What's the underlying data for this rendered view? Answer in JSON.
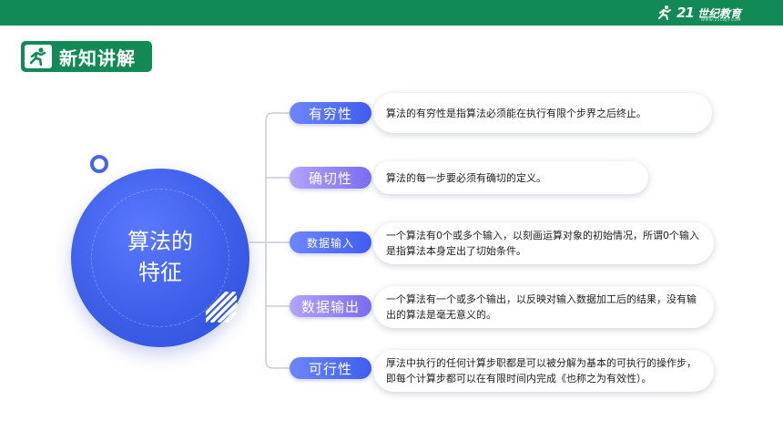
{
  "header": {
    "brand_mark": "21",
    "brand_text": "世纪教育",
    "brand_sub": "WWW.21CNJY.COM"
  },
  "section": {
    "icon": "runner-icon",
    "title": "新知讲解"
  },
  "center": {
    "title_line1": "算法的",
    "title_line2": "特征"
  },
  "features": [
    {
      "label": "有穷性",
      "description": "算法的有穷性是指算法必须能在执行有限个步界之后终止。"
    },
    {
      "label": "确切性",
      "description": "算法的每一步要必须有确切的定义。"
    },
    {
      "label": "数据输入",
      "description": "一个算法有0个或多个输入，以刻画运算对象的初始情况，所谓0个输入是指算法本身定出了切始条件。"
    },
    {
      "label": "数据输出",
      "description": "一个算法有一个或多个输出，以反映对输入数据加工后的结果，没有输出的算法是毫无意义的。"
    },
    {
      "label": "可行性",
      "description": "厚法中执行的任何计算步职都是可以被分解为基本的可执行的操作步，即每个计算步都可以在有限时间内完成《也称之为有效性）。"
    }
  ],
  "colors": {
    "header_green": "#128a55",
    "circle_blue": "#3d5ee9",
    "pill_blue": "#3f5ef0",
    "pill_purple": "#7a6cf0"
  }
}
